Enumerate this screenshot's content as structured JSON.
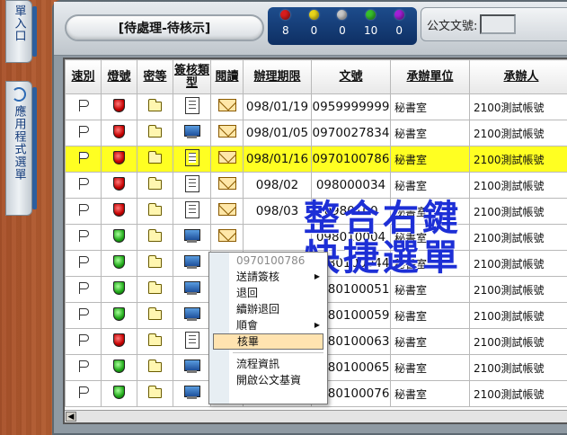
{
  "left_tabs": [
    {
      "label": "單入口"
    },
    {
      "label": "應用程式選單"
    }
  ],
  "header": {
    "title": "[待處理-待核示]",
    "counters": [
      {
        "color": "#d81d1d",
        "count": "8"
      },
      {
        "color": "#e8d51a",
        "count": "0"
      },
      {
        "color": "#c8c8c8",
        "count": "0"
      },
      {
        "color": "#37c02c",
        "count": "10"
      },
      {
        "color": "#a21fd6",
        "count": "0"
      }
    ],
    "search_label": "公文文號:"
  },
  "columns": [
    "速別",
    "燈號",
    "密等",
    "簽核類型",
    "閱讀",
    "辦理期限",
    "文號",
    "承辦單位",
    "承辦人"
  ],
  "rows": [
    {
      "light": "red",
      "type": "doc",
      "date": "098/01/19",
      "doc": "0959999999",
      "unit": "秘書室",
      "user": "2100測試帳號",
      "selected": false
    },
    {
      "light": "red",
      "type": "monitor",
      "date": "098/01/05",
      "doc": "0970027834",
      "unit": "秘書室",
      "user": "2100測試帳號",
      "selected": false
    },
    {
      "light": "red",
      "type": "doc",
      "date": "098/01/16",
      "doc": "0970100786",
      "unit": "秘書室",
      "user": "2100測試帳號",
      "selected": true
    },
    {
      "light": "red",
      "type": "doc",
      "date": "098/02",
      "doc": "098000034",
      "unit": "秘書室",
      "user": "2100測試帳號",
      "selected": false
    },
    {
      "light": "red",
      "type": "doc",
      "date": "098/03",
      "doc": "0980100",
      "unit": "秘書室",
      "user": "2100測試帳號",
      "selected": false
    },
    {
      "light": "green",
      "type": "monitor",
      "date": "",
      "doc": "098010004",
      "unit": "秘書室",
      "user": "2100測試帳號",
      "selected": false
    },
    {
      "light": "green",
      "type": "monitor",
      "date": "",
      "doc": "0980100044",
      "unit": "秘書室",
      "user": "2100測試帳號",
      "selected": false
    },
    {
      "light": "green",
      "type": "monitor",
      "date": "",
      "doc": "0980100051",
      "unit": "秘書室",
      "user": "2100測試帳號",
      "selected": false
    },
    {
      "light": "green",
      "type": "monitor",
      "date": "",
      "doc": "0980100059",
      "unit": "秘書室",
      "user": "2100測試帳號",
      "selected": false
    },
    {
      "light": "red",
      "type": "doc",
      "date": "",
      "doc": "0980100063",
      "unit": "秘書室",
      "user": "2100測試帳號",
      "selected": false
    },
    {
      "light": "green",
      "type": "monitor",
      "date": "",
      "doc": "0980100065",
      "unit": "秘書室",
      "user": "2100測試帳號",
      "selected": false
    },
    {
      "light": "green",
      "type": "monitor",
      "date": "",
      "doc": "0980100076",
      "unit": "秘書室",
      "user": "2100測試帳號",
      "selected": false
    }
  ],
  "context_menu": {
    "header": "0970100786",
    "items": [
      {
        "label": "送請簽核",
        "submenu": true
      },
      {
        "label": "退回",
        "submenu": false
      },
      {
        "label": "續辦退回",
        "submenu": false
      },
      {
        "label": "順會",
        "submenu": true
      },
      {
        "label": "核畢",
        "submenu": false,
        "highlighted": true
      },
      {
        "label": "流程資訊",
        "submenu": false
      },
      {
        "label": "開啟公文基資",
        "submenu": false
      }
    ]
  },
  "caption": {
    "line1": "整合右鍵",
    "line2": "快捷選單"
  }
}
